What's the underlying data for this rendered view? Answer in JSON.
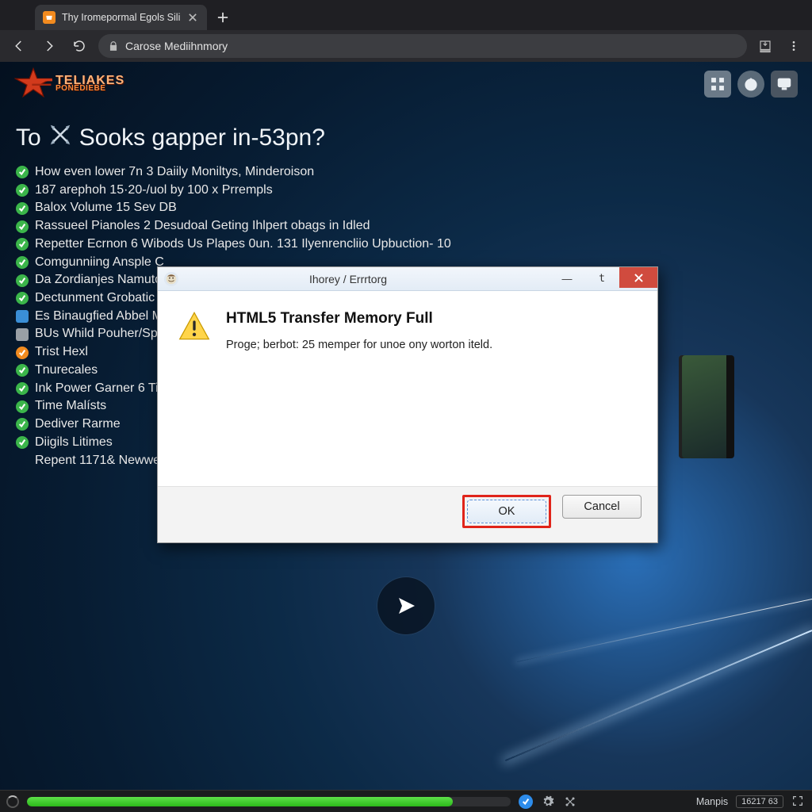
{
  "browser": {
    "tab_title": "Thy Iromepormal Egols Sili",
    "omnibox": "Carose Mediihnmory"
  },
  "page": {
    "logo_line1": "TELIAKES",
    "logo_line2": "PONEDIEBE",
    "heading_prefix": "To",
    "heading_rest": "Sooks gapper in-53pn?",
    "items": [
      {
        "kind": "green",
        "text": "How even lower 7n 3 Daiily Moniltys, Minderoison"
      },
      {
        "kind": "green",
        "text": "187 arephoh 15·20-/uol by 100 x Prrempls"
      },
      {
        "kind": "green",
        "text": "Balox Volume 15 Sev DB"
      },
      {
        "kind": "green",
        "text": "Rassueel Pianoles 2 Desudoal Geting Ihlpert obags in Idled"
      },
      {
        "kind": "green",
        "text": "Repetter Ecrnon 6 Wibods Us Plapes 0un. 131 Ilyenrencliio Upbuction- 10"
      },
      {
        "kind": "green",
        "text": "Comgunniing Ansple C"
      },
      {
        "kind": "green",
        "text": "Da Zordianjes Namuto"
      },
      {
        "kind": "green",
        "text": "Dectunment Grobatic"
      },
      {
        "kind": "blue",
        "text": "Es Binaugfied Abbel M"
      },
      {
        "kind": "grey",
        "text": "BUs Whild Pouher/Sp"
      },
      {
        "kind": "orange",
        "text": "Trist Hexl"
      },
      {
        "kind": "green",
        "text": "Tnurecales"
      },
      {
        "kind": "green",
        "text": "Ink Power Garner 6 Ti"
      },
      {
        "kind": "green",
        "text": "Time Malísts"
      },
      {
        "kind": "green",
        "text": "Dediver Rarme"
      },
      {
        "kind": "green",
        "text": "Diigils Litimes"
      },
      {
        "kind": "indent",
        "text": "Repent 1171& Newwe"
      }
    ]
  },
  "dialog": {
    "title": "Ihorey / Errrtorg",
    "heading": "HTML5 Transfer Memory Full",
    "message": "Proge; berbot: 25 memper for unoe ony worton iteld.",
    "ok_label": "OK",
    "cancel_label": "Cancel"
  },
  "status": {
    "label": "Manpis",
    "counter": "16217 63"
  }
}
